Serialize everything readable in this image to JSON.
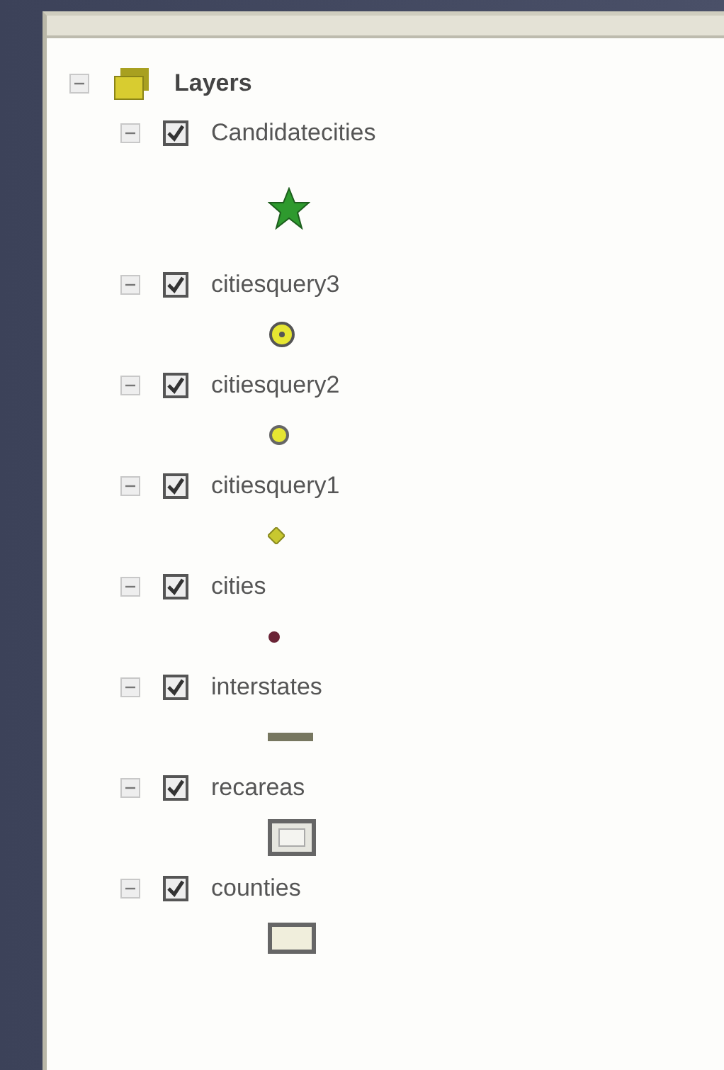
{
  "tree": {
    "label": "Layers",
    "expanded": true,
    "layers": [
      {
        "label": "Candidatecities",
        "checked": true,
        "expanded": true,
        "symbol": {
          "kind": "star"
        }
      },
      {
        "label": "citiesquery3",
        "checked": true,
        "expanded": true,
        "symbol": {
          "kind": "ringdot"
        }
      },
      {
        "label": "citiesquery2",
        "checked": true,
        "expanded": true,
        "symbol": {
          "kind": "ring"
        }
      },
      {
        "label": "citiesquery1",
        "checked": true,
        "expanded": true,
        "symbol": {
          "kind": "diamond"
        }
      },
      {
        "label": "cities",
        "checked": true,
        "expanded": true,
        "symbol": {
          "kind": "dot"
        }
      },
      {
        "label": "interstates",
        "checked": true,
        "expanded": true,
        "symbol": {
          "kind": "line"
        }
      },
      {
        "label": "recareas",
        "checked": true,
        "expanded": true,
        "symbol": {
          "kind": "hatchbox"
        }
      },
      {
        "label": "counties",
        "checked": true,
        "expanded": true,
        "symbol": {
          "kind": "box"
        }
      }
    ]
  }
}
